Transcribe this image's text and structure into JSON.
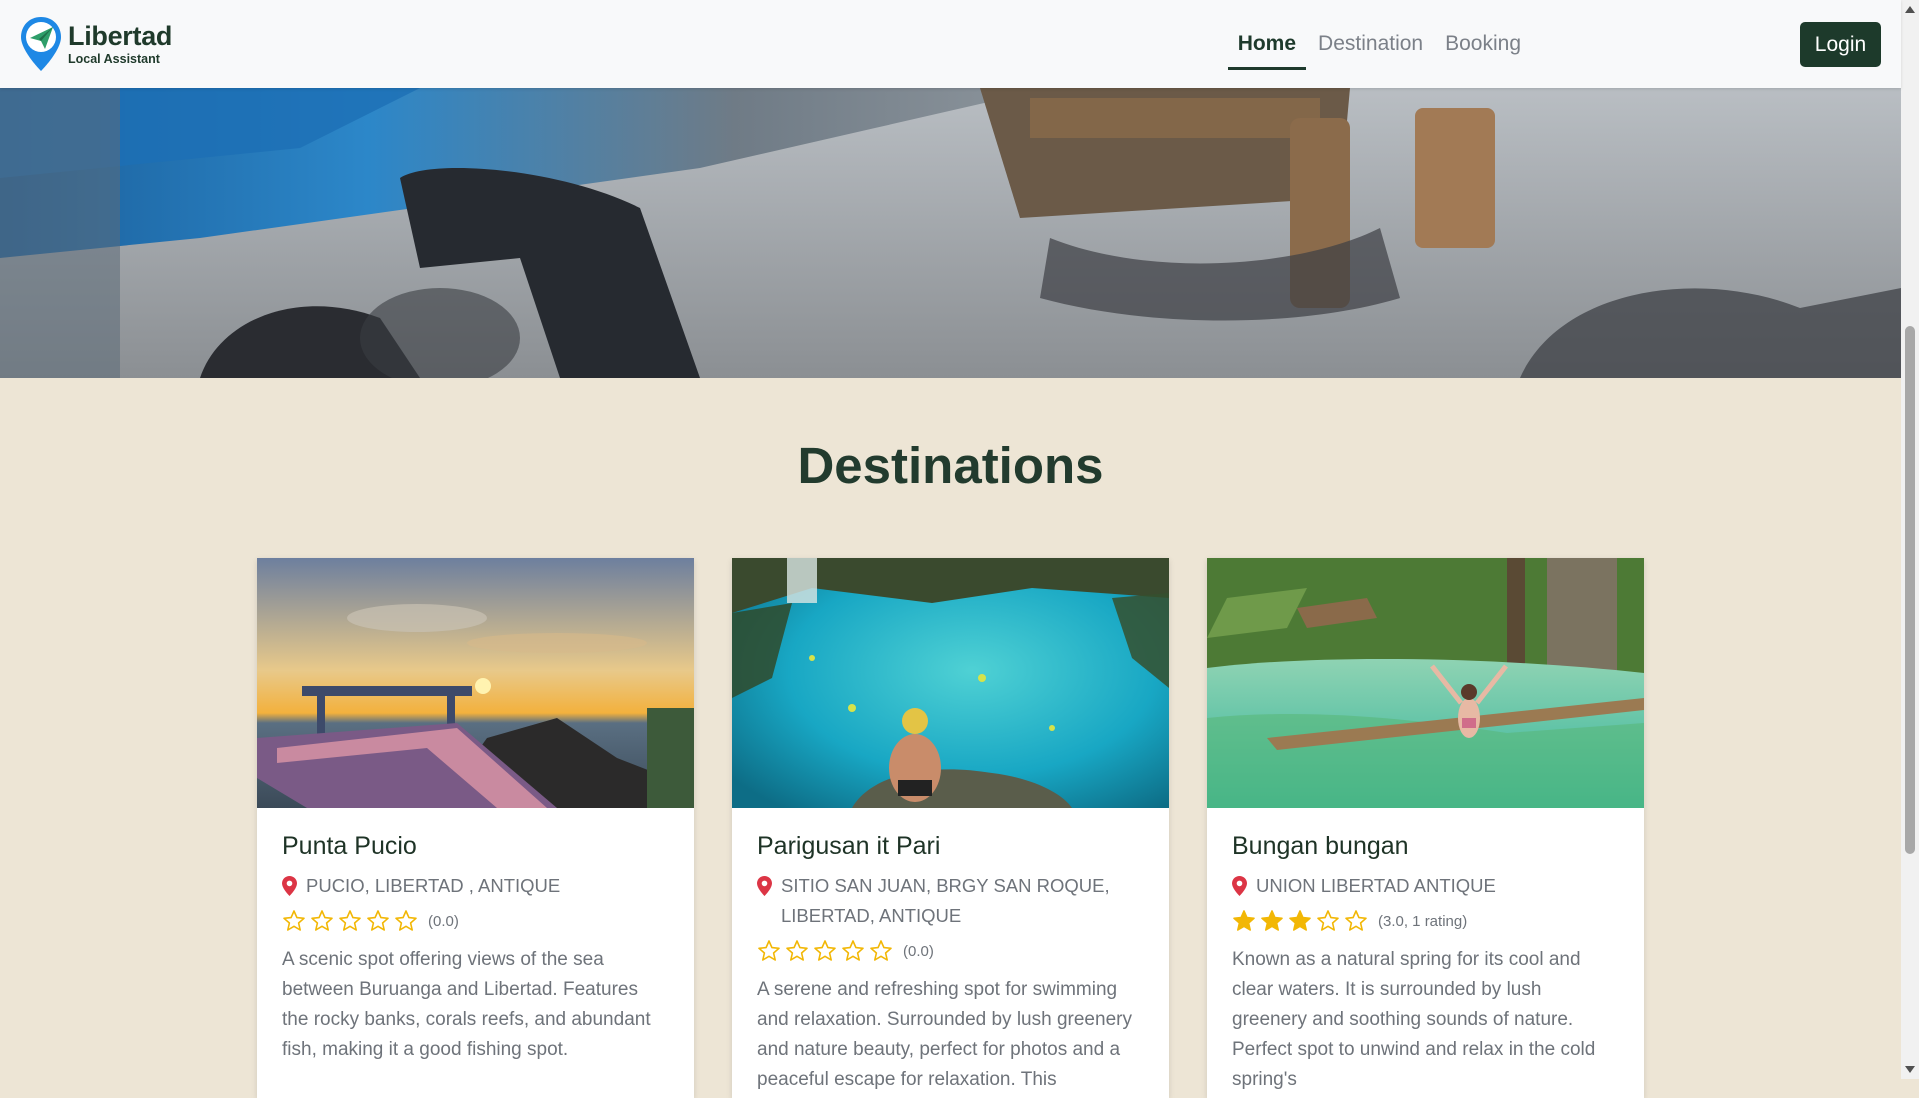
{
  "brand": {
    "name": "Libertad",
    "subtitle": "Local Assistant"
  },
  "nav": {
    "links": [
      {
        "label": "Home",
        "active": true
      },
      {
        "label": "Destination",
        "active": false
      },
      {
        "label": "Booking",
        "active": false
      }
    ],
    "login_label": "Login"
  },
  "section": {
    "title": "Destinations"
  },
  "destinations": [
    {
      "name": "Punta Pucio",
      "location": "PUCIO, LIBERTAD , ANTIQUE",
      "rating": 0,
      "rating_text": "(0.0)",
      "description": "A scenic spot offering views of the sea between Buruanga and Libertad. Features the rocky banks, corals reefs, and abundant fish, making it a good fishing spot."
    },
    {
      "name": "Parigusan it Pari",
      "location": "SITIO SAN JUAN, BRGY SAN ROQUE, LIBERTAD, ANTIQUE",
      "rating": 0,
      "rating_text": "(0.0)",
      "description": "A serene and refreshing spot for swimming and relaxation. Surrounded by lush greenery and nature beauty, perfect for photos and a peaceful escape for relaxation. This"
    },
    {
      "name": "Bungan bungan",
      "location": "UNION LIBERTAD ANTIQUE",
      "rating": 3,
      "rating_text": "(3.0, 1 rating)",
      "description": "Known as a natural spring for its cool and clear waters. It is surrounded by lush greenery and soothing sounds of nature. Perfect spot to unwind and relax in the cold spring's"
    }
  ],
  "colors": {
    "brand_dark": "#1d3a2b",
    "page_bg": "#ede5d5",
    "star": "#f2b705",
    "pin": "#dc3545",
    "logo_blue": "#1e88e5"
  }
}
